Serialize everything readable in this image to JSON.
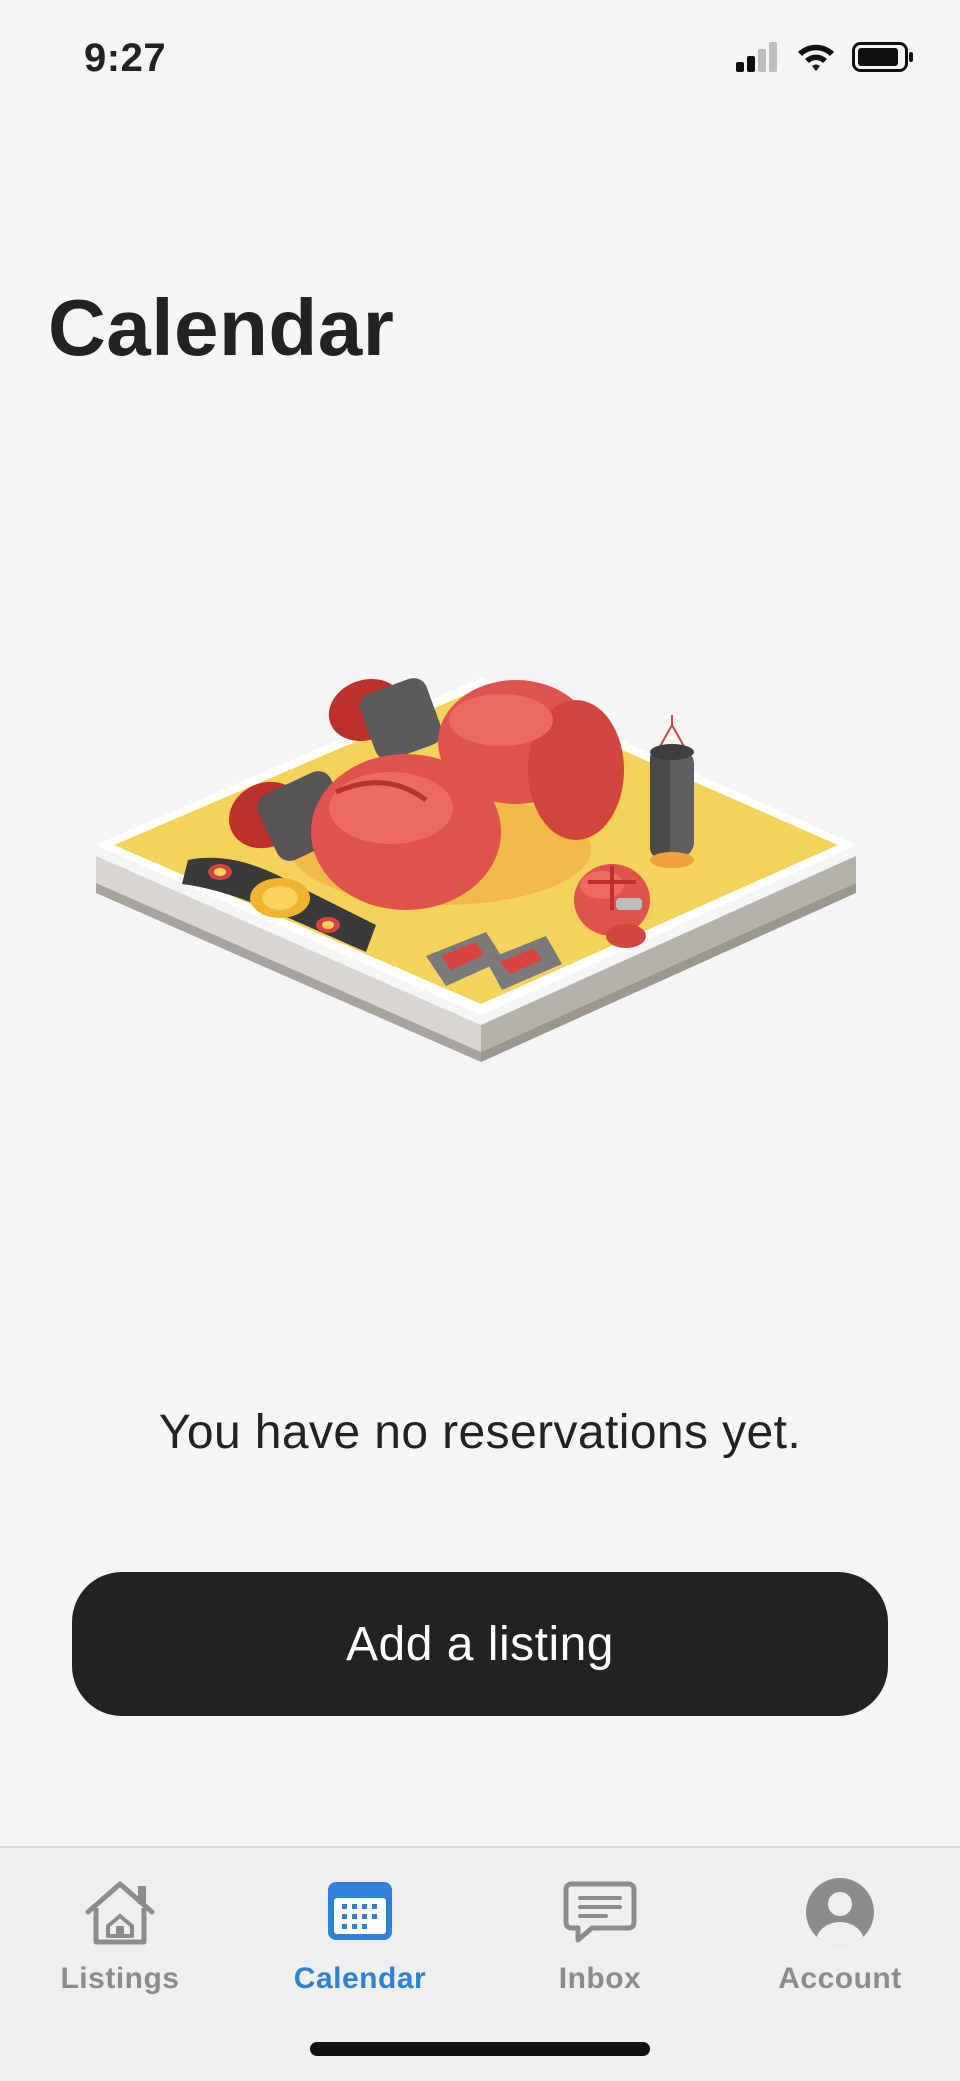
{
  "status_bar": {
    "time": "9:27"
  },
  "page": {
    "title": "Calendar",
    "empty_message": "You have no reservations yet.",
    "primary_button": "Add a listing"
  },
  "tab_bar": {
    "active_color": "#2f80d8",
    "inactive_color": "#8c8c8c",
    "tabs": [
      {
        "label": "Listings",
        "icon": "house-icon",
        "active": false
      },
      {
        "label": "Calendar",
        "icon": "calendar-icon",
        "active": true
      },
      {
        "label": "Inbox",
        "icon": "message-icon",
        "active": false
      },
      {
        "label": "Account",
        "icon": "person-icon",
        "active": false
      }
    ]
  },
  "colors": {
    "background": "#f5f5f5",
    "button": "#222222",
    "illustration_mat": "#f4d35a",
    "illustration_gloves": "#e0524c"
  }
}
